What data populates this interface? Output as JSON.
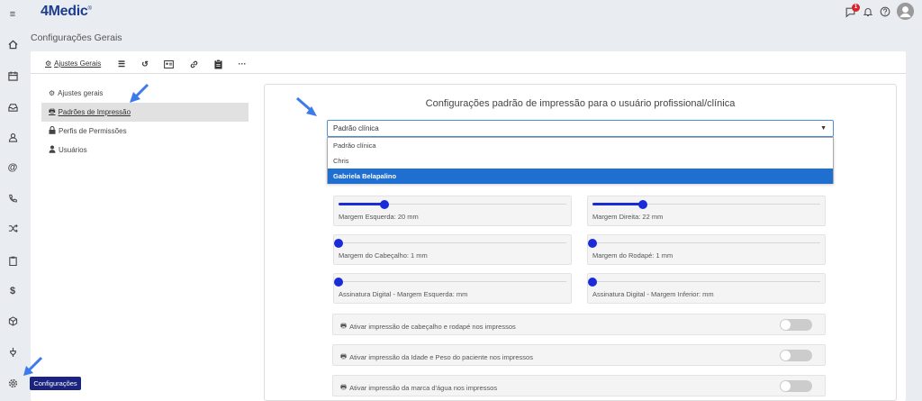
{
  "brand": {
    "name": "4Medic",
    "mark": "®"
  },
  "header": {
    "notification_count": "1"
  },
  "page": {
    "title": "Configurações Gerais"
  },
  "toolbar": {
    "link_label": "Ajustes Gerais"
  },
  "leftnav": {
    "items": [
      {
        "label": "Ajustes gerais"
      },
      {
        "label": "Padrões de Impressão"
      },
      {
        "label": "Perfis de Permissões"
      },
      {
        "label": "Usuários"
      }
    ]
  },
  "panel": {
    "title": "Configurações padrão de impressão para o usuário profissional/clínica",
    "select": {
      "value": "Padrão clínica",
      "options": [
        "Padrão clínica",
        "Chris",
        "Gabriela Belapalino"
      ],
      "highlighted": "Gabriela Belapalino"
    }
  },
  "sliders": [
    {
      "label": "Margem Esquerda: 20 mm",
      "level": 0.2
    },
    {
      "label": "Margem Direita: 22 mm",
      "level": 0.22
    },
    {
      "label": "Margem do Cabeçalho: 1 mm",
      "level": 0
    },
    {
      "label": "Margem do Rodapé: 1 mm",
      "level": 0
    },
    {
      "label": "Assinatura Digital - Margem Esquerda: mm",
      "level": 0
    },
    {
      "label": "Assinatura Digital - Margem Inferior: mm",
      "level": 0
    }
  ],
  "toggles": [
    {
      "label": "Ativar impressão de cabeçalho e rodapé nos impressos",
      "on": false
    },
    {
      "label": "Ativar impressão da Idade e Peso do paciente nos impressos",
      "on": false
    },
    {
      "label": "Ativar impressão da marca d'água nos impressos",
      "on": false
    }
  ],
  "tooltip": {
    "text": "Configurações"
  },
  "colors": {
    "accent": "#1a2bd8",
    "selected": "#1e6fd0",
    "arrow": "#3b7bea",
    "brand": "#1e3c8c"
  }
}
